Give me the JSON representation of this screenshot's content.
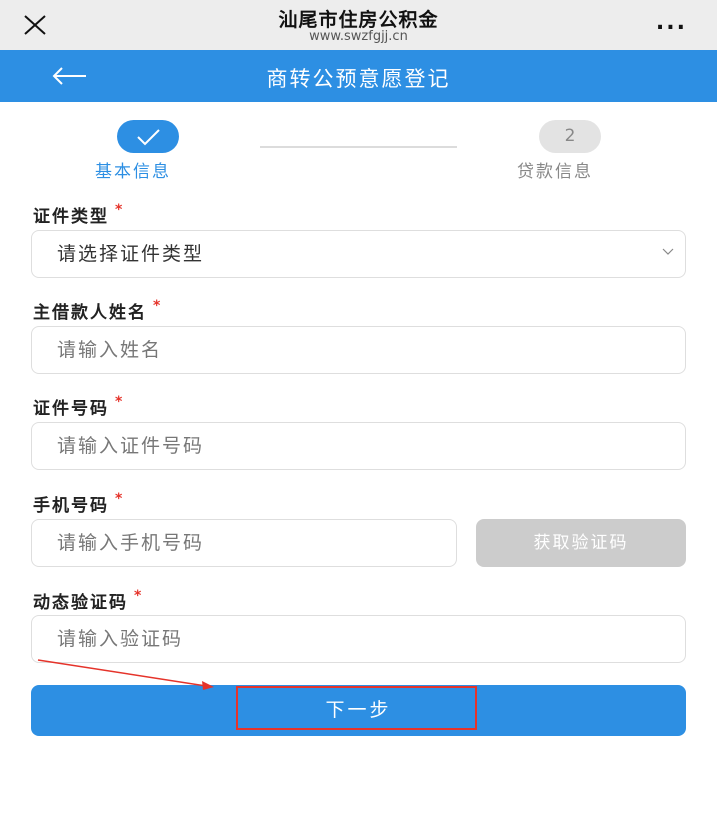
{
  "topbar": {
    "title": "汕尾市住房公积金",
    "url": "www.swzfgjj.cn",
    "more": "..."
  },
  "header": {
    "title": "商转公预意愿登记"
  },
  "steps": [
    {
      "label": "基本信息",
      "state": "done"
    },
    {
      "label": "贷款信息",
      "number": "2",
      "state": "pending"
    }
  ],
  "form": {
    "id_type": {
      "label": "证件类型",
      "required_mark": "*",
      "value": "请选择证件类型"
    },
    "name": {
      "label": "主借款人姓名",
      "required_mark": "*",
      "placeholder": "请输入姓名"
    },
    "id_number": {
      "label": "证件号码",
      "required_mark": "*",
      "placeholder": "请输入证件号码"
    },
    "phone": {
      "label": "手机号码",
      "required_mark": "*",
      "placeholder": "请输入手机号码",
      "code_button": "获取验证码"
    },
    "sms_code": {
      "label": "动态验证码",
      "required_mark": "*",
      "placeholder": "请输入验证码"
    }
  },
  "next_button": "下一步",
  "colors": {
    "primary": "#2d8fe3",
    "annotation": "#e5332a",
    "disabled": "#cccccc"
  },
  "icons": [
    "close-icon",
    "more-icon",
    "back-arrow-icon",
    "check-icon",
    "chevron-down-icon"
  ]
}
